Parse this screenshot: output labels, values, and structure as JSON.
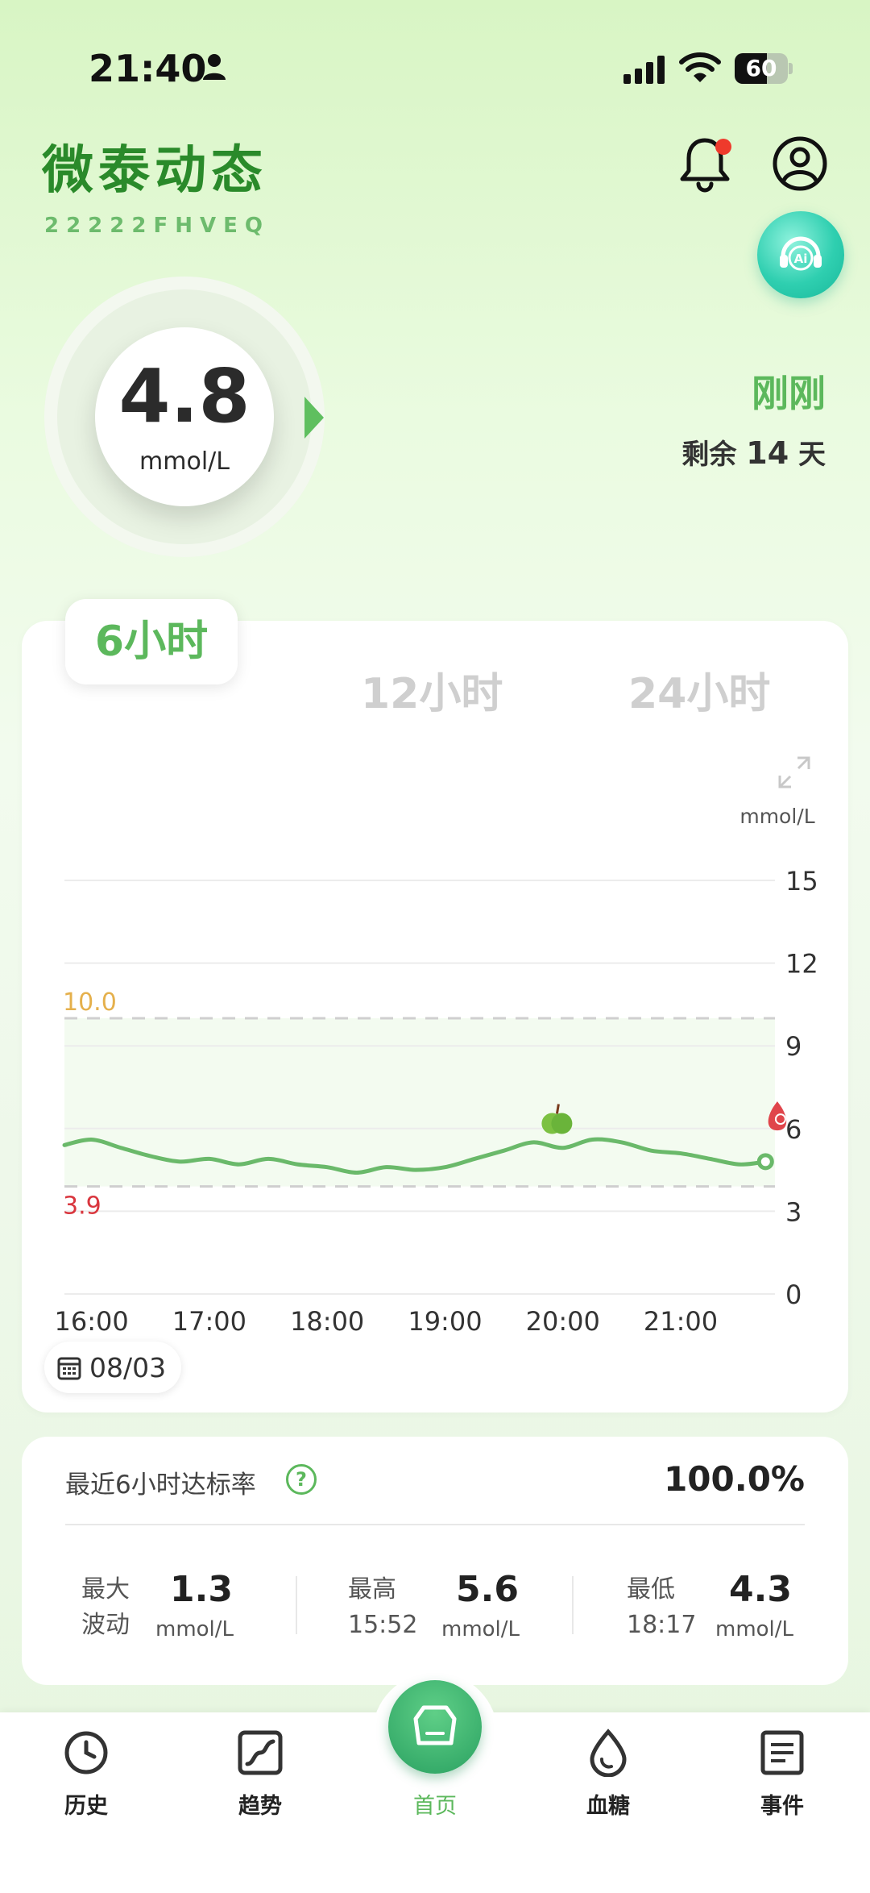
{
  "status_bar": {
    "time": "21:40",
    "battery": "60",
    "battery_level": 0.6
  },
  "header": {
    "app_title": "微泰动态",
    "device_id": "22222FHVEQ"
  },
  "glucose": {
    "value": "4.8",
    "unit": "mmol/L",
    "updated": "刚刚",
    "remaining_prefix": "剩余 ",
    "remaining_days": "14",
    "remaining_suffix": " 天"
  },
  "tabs": {
    "active": "6小时",
    "t12": "12小时",
    "t24": "24小时"
  },
  "chart_data": {
    "type": "line",
    "ylabel": "mmol/L",
    "ylim": [
      0,
      15
    ],
    "yticks": [
      "15",
      "12",
      "9",
      "6",
      "3",
      "0"
    ],
    "xticks": [
      "16:00",
      "17:00",
      "18:00",
      "19:00",
      "20:00",
      "21:00"
    ],
    "xlim": [
      15.77,
      21.8
    ],
    "target_high": "10.0",
    "target_low": "3.9",
    "target_high_value": 10.0,
    "target_low_value": 3.9,
    "grid": true,
    "colors": {
      "line": "#6ab96a",
      "high": "#e5b04c",
      "low": "#d9363e",
      "band": "#f3fbf0"
    },
    "x": [
      15.77,
      16.0,
      16.25,
      16.5,
      16.75,
      17.0,
      17.25,
      17.5,
      17.75,
      18.0,
      18.25,
      18.5,
      18.75,
      19.0,
      19.25,
      19.5,
      19.75,
      20.0,
      20.25,
      20.5,
      20.75,
      21.0,
      21.25,
      21.5,
      21.72
    ],
    "values": [
      5.4,
      5.6,
      5.3,
      5.0,
      4.8,
      4.9,
      4.7,
      4.9,
      4.7,
      4.6,
      4.4,
      4.6,
      4.5,
      4.6,
      4.9,
      5.2,
      5.5,
      5.3,
      5.6,
      5.5,
      5.2,
      5.1,
      4.9,
      4.7,
      4.8
    ],
    "events": [
      {
        "type": "meal",
        "x": 19.95,
        "y": 6.3
      },
      {
        "type": "fingerstick",
        "x": 21.82,
        "y": 6.4
      }
    ],
    "date": "08/03"
  },
  "stats": {
    "rate_label": "最近6小时达标率",
    "rate_value": "100.0%",
    "help": "?",
    "max_fluct_label1": "最大",
    "max_fluct_label2": "波动",
    "max_fluct_value": "1.3",
    "max_fluct_unit": "mmol/L",
    "highest_label": "最高",
    "highest_time": "15:52",
    "highest_value": "5.6",
    "highest_unit": "mmol/L",
    "lowest_label": "最低",
    "lowest_time": "18:17",
    "lowest_value": "4.3",
    "lowest_unit": "mmol/L"
  },
  "nav": {
    "history": "历史",
    "trend": "趋势",
    "home": "首页",
    "glucose": "血糖",
    "events": "事件",
    "active_color": "#5cb85c"
  }
}
